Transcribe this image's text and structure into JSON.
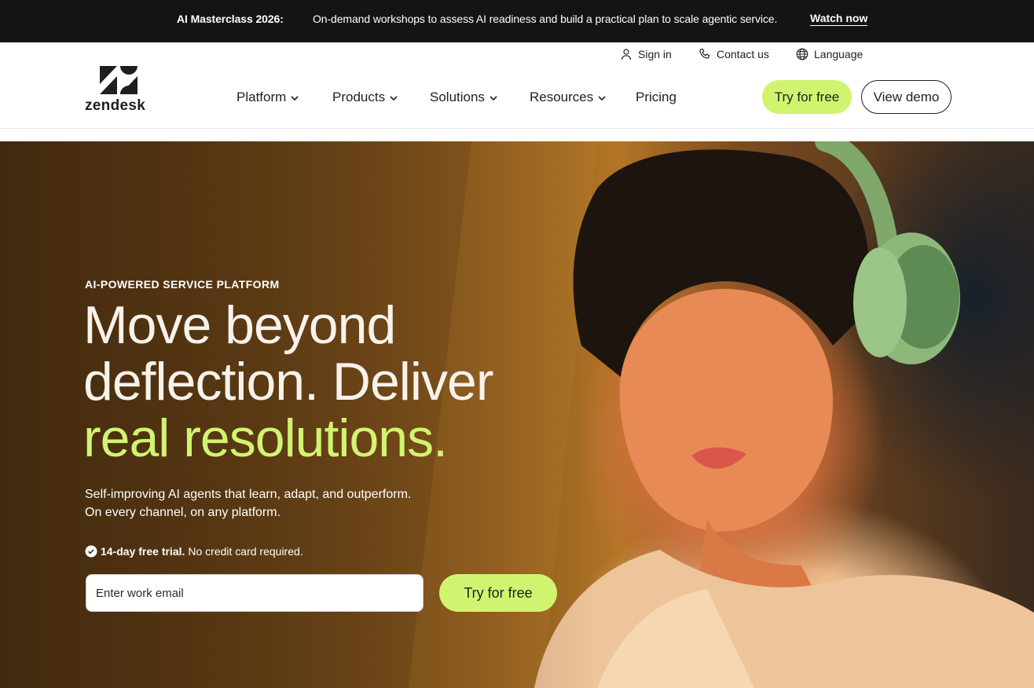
{
  "announcement": {
    "title": "AI Masterclass 2026:",
    "text": "On-demand workshops to assess AI readiness and build a practical plan to scale agentic service.",
    "link": "Watch now"
  },
  "brand": {
    "wordmark": "zendesk",
    "colors": {
      "accent": "#d1f470",
      "dark": "#141412",
      "ink": "#1f1f1f"
    }
  },
  "utility_nav": [
    {
      "label": "Sign in",
      "icon": "user-icon"
    },
    {
      "label": "Contact us",
      "icon": "phone-icon"
    },
    {
      "label": "Language",
      "icon": "globe-icon"
    }
  ],
  "main_nav": [
    {
      "label": "Platform",
      "dropdown": true
    },
    {
      "label": "Products",
      "dropdown": true
    },
    {
      "label": "Solutions",
      "dropdown": true
    },
    {
      "label": "Resources",
      "dropdown": true
    },
    {
      "label": "Pricing",
      "dropdown": false
    }
  ],
  "header_cta": {
    "try": "Try for free",
    "demo": "View demo"
  },
  "hero": {
    "eyebrow": "AI-POWERED SERVICE PLATFORM",
    "headline_line1": "Move beyond",
    "headline_line2": "deflection. Deliver",
    "headline_accent": "real resolutions.",
    "sub_line1": "Self-improving AI agents that learn, adapt, and outperform.",
    "sub_line2": "On every channel, on any platform.",
    "trial_bold": "14-day free trial.",
    "trial_rest": "No credit card required.",
    "email_placeholder": "Enter work email",
    "cta": "Try for free"
  }
}
